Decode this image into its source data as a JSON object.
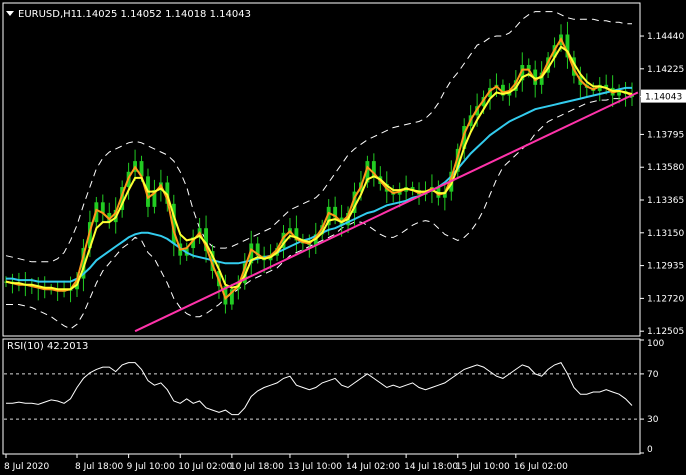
{
  "chart_data": {
    "type": "candlestick",
    "colors": {
      "background": "#000000",
      "frame": "#ffffff",
      "candle": "#22cc22",
      "ma_fast": "#ff9a1a",
      "ma_mid": "#ffff33",
      "ma_slow": "#33ccee",
      "bands": "#ffffff",
      "trendline": "#ff33aa",
      "rsi": "#ffffff",
      "price_tag_bg": "#ffffff",
      "price_tag_text": "#000000"
    },
    "header": {
      "symbol": "EURUSD,H1",
      "ohlc": "1.14025 1.14052 1.14018 1.14043"
    },
    "price_panel": {
      "ylim": [
        1.1248,
        1.1465
      ],
      "y_ticks": [
        "1.14440",
        "1.14225",
        "1.14043",
        "1.13795",
        "1.13580",
        "1.13365",
        "1.13150",
        "1.12935",
        "1.12720",
        "1.12505"
      ],
      "current_price": "1.14043",
      "close": [
        1.1283,
        1.1282,
        1.1281,
        1.1281,
        1.128,
        1.1279,
        1.1278,
        1.1278,
        1.1277,
        1.1277,
        1.1278,
        1.1285,
        1.1305,
        1.1322,
        1.1335,
        1.1328,
        1.1322,
        1.133,
        1.1345,
        1.1355,
        1.1362,
        1.1352,
        1.1332,
        1.1343,
        1.1348,
        1.1334,
        1.1308,
        1.13,
        1.1305,
        1.1312,
        1.1318,
        1.1303,
        1.129,
        1.128,
        1.1268,
        1.1278,
        1.1282,
        1.1295,
        1.1308,
        1.13,
        1.1297,
        1.13,
        1.1305,
        1.1315,
        1.1318,
        1.131,
        1.1308,
        1.1307,
        1.1314,
        1.132,
        1.1332,
        1.1325,
        1.132,
        1.1328,
        1.1342,
        1.1348,
        1.1362,
        1.1352,
        1.1347,
        1.1342,
        1.134,
        1.1342,
        1.1345,
        1.1343,
        1.134,
        1.1342,
        1.1345,
        1.1338,
        1.1342,
        1.1355,
        1.137,
        1.1385,
        1.1392,
        1.1398,
        1.1404,
        1.141,
        1.1412,
        1.1405,
        1.1408,
        1.1415,
        1.1425,
        1.1422,
        1.1412,
        1.142,
        1.143,
        1.1438,
        1.1445,
        1.143,
        1.1418,
        1.1412,
        1.141,
        1.1408,
        1.1412,
        1.141,
        1.1405,
        1.1408,
        1.1406,
        1.1404
      ],
      "ma_fast": [
        1.1283,
        1.1282,
        1.1281,
        1.1281,
        1.128,
        1.1279,
        1.1278,
        1.1278,
        1.1277,
        1.1277,
        1.1278,
        1.1284,
        1.13,
        1.1316,
        1.133,
        1.1328,
        1.1324,
        1.1328,
        1.134,
        1.1351,
        1.1358,
        1.1352,
        1.1338,
        1.1341,
        1.1346,
        1.1337,
        1.1316,
        1.1304,
        1.1305,
        1.131,
        1.1315,
        1.1306,
        1.1294,
        1.1284,
        1.1272,
        1.1276,
        1.128,
        1.1292,
        1.1304,
        1.1301,
        1.1298,
        1.13,
        1.1304,
        1.1312,
        1.1316,
        1.1311,
        1.1309,
        1.1308,
        1.1312,
        1.1318,
        1.1328,
        1.1326,
        1.1322,
        1.1326,
        1.1338,
        1.1345,
        1.1358,
        1.1354,
        1.1349,
        1.1344,
        1.1341,
        1.1342,
        1.1344,
        1.1343,
        1.1341,
        1.1342,
        1.1344,
        1.134,
        1.1341,
        1.1351,
        1.1365,
        1.138,
        1.1389,
        1.1396,
        1.1402,
        1.1408,
        1.1411,
        1.1407,
        1.1408,
        1.1413,
        1.1422,
        1.1422,
        1.1415,
        1.1418,
        1.1427,
        1.1435,
        1.1442,
        1.1433,
        1.1422,
        1.1415,
        1.1411,
        1.1409,
        1.1411,
        1.141,
        1.1407,
        1.1408,
        1.1407,
        1.1405
      ],
      "ma_mid": [
        1.1283,
        1.1282,
        1.1282,
        1.1281,
        1.1281,
        1.128,
        1.1279,
        1.1279,
        1.1278,
        1.1278,
        1.1278,
        1.1281,
        1.1292,
        1.1305,
        1.1318,
        1.1322,
        1.1322,
        1.1325,
        1.1334,
        1.1343,
        1.1351,
        1.1351,
        1.1342,
        1.1342,
        1.1344,
        1.134,
        1.1326,
        1.1314,
        1.131,
        1.1311,
        1.1313,
        1.1308,
        1.13,
        1.1291,
        1.1281,
        1.1279,
        1.128,
        1.1287,
        1.1297,
        1.1299,
        1.1298,
        1.1299,
        1.1302,
        1.1308,
        1.1313,
        1.1312,
        1.131,
        1.1309,
        1.1311,
        1.1315,
        1.1323,
        1.1324,
        1.1322,
        1.1324,
        1.1332,
        1.134,
        1.135,
        1.1352,
        1.135,
        1.1346,
        1.1343,
        1.1343,
        1.1344,
        1.1343,
        1.1342,
        1.1342,
        1.1343,
        1.1341,
        1.1341,
        1.1347,
        1.1358,
        1.1371,
        1.1381,
        1.1389,
        1.1396,
        1.1403,
        1.1407,
        1.1406,
        1.1407,
        1.141,
        1.1417,
        1.1419,
        1.1416,
        1.1417,
        1.1423,
        1.143,
        1.1437,
        1.1434,
        1.1426,
        1.1419,
        1.1414,
        1.1411,
        1.1411,
        1.141,
        1.1408,
        1.1408,
        1.1407,
        1.1406
      ],
      "ma_slow": [
        1.1285,
        1.1285,
        1.1284,
        1.1284,
        1.1284,
        1.1283,
        1.1283,
        1.1283,
        1.1283,
        1.1283,
        1.1283,
        1.1285,
        1.1288,
        1.1292,
        1.1297,
        1.13,
        1.1303,
        1.1306,
        1.1309,
        1.1312,
        1.1314,
        1.1315,
        1.1315,
        1.1314,
        1.1313,
        1.1311,
        1.1308,
        1.1305,
        1.1302,
        1.13,
        1.1299,
        1.1298,
        1.1297,
        1.1296,
        1.1295,
        1.1295,
        1.1295,
        1.1296,
        1.1297,
        1.1298,
        1.1299,
        1.13,
        1.1302,
        1.1304,
        1.1306,
        1.1308,
        1.131,
        1.1311,
        1.1313,
        1.1315,
        1.1317,
        1.1318,
        1.132,
        1.1322,
        1.1324,
        1.1326,
        1.1328,
        1.1329,
        1.1331,
        1.1333,
        1.1334,
        1.1335,
        1.1336,
        1.1338,
        1.1339,
        1.1341,
        1.1343,
        1.1345,
        1.1348,
        1.1352,
        1.1357,
        1.1362,
        1.1367,
        1.1371,
        1.1375,
        1.1379,
        1.1382,
        1.1385,
        1.1388,
        1.139,
        1.1392,
        1.1394,
        1.1396,
        1.1397,
        1.1398,
        1.1399,
        1.14,
        1.1401,
        1.1402,
        1.1403,
        1.1404,
        1.1405,
        1.1406,
        1.1407,
        1.1408,
        1.1409,
        1.141,
        1.141
      ],
      "band_upper": [
        1.13,
        1.1299,
        1.1298,
        1.1297,
        1.1296,
        1.1296,
        1.1296,
        1.1296,
        1.1298,
        1.1302,
        1.131,
        1.132,
        1.1333,
        1.1345,
        1.1357,
        1.1364,
        1.1368,
        1.137,
        1.1372,
        1.1374,
        1.1375,
        1.1374,
        1.1372,
        1.137,
        1.1368,
        1.1366,
        1.1362,
        1.1355,
        1.1345,
        1.133,
        1.1318,
        1.131,
        1.1306,
        1.1305,
        1.1305,
        1.1306,
        1.1308,
        1.131,
        1.1312,
        1.1314,
        1.1316,
        1.1318,
        1.1322,
        1.1326,
        1.133,
        1.1332,
        1.1334,
        1.1336,
        1.1338,
        1.1342,
        1.1348,
        1.1354,
        1.136,
        1.1366,
        1.137,
        1.1373,
        1.1376,
        1.1378,
        1.138,
        1.1382,
        1.1384,
        1.1385,
        1.1386,
        1.1387,
        1.1388,
        1.139,
        1.1394,
        1.14,
        1.1408,
        1.1415,
        1.142,
        1.1426,
        1.1432,
        1.1438,
        1.144,
        1.1443,
        1.1444,
        1.1444,
        1.1446,
        1.145,
        1.1455,
        1.1458,
        1.146,
        1.146,
        1.146,
        1.146,
        1.1458,
        1.1456,
        1.1455,
        1.1455,
        1.1455,
        1.1455,
        1.1454,
        1.1454,
        1.1453,
        1.1453,
        1.1452,
        1.1452
      ],
      "band_lower": [
        1.1268,
        1.1268,
        1.1268,
        1.1267,
        1.1266,
        1.1264,
        1.1262,
        1.126,
        1.1257,
        1.1254,
        1.1252,
        1.1255,
        1.1262,
        1.1272,
        1.1282,
        1.129,
        1.1295,
        1.13,
        1.1305,
        1.1308,
        1.1312,
        1.131,
        1.1302,
        1.1298,
        1.129,
        1.1282,
        1.1272,
        1.1266,
        1.1262,
        1.126,
        1.126,
        1.1262,
        1.1265,
        1.1268,
        1.1272,
        1.1275,
        1.1278,
        1.1281,
        1.1284,
        1.1286,
        1.1288,
        1.129,
        1.1292,
        1.1296,
        1.13,
        1.1302,
        1.1304,
        1.1306,
        1.1308,
        1.131,
        1.1312,
        1.1314,
        1.1318,
        1.132,
        1.1322,
        1.1322,
        1.132,
        1.1317,
        1.1314,
        1.1312,
        1.1312,
        1.1314,
        1.1317,
        1.132,
        1.1322,
        1.1323,
        1.1322,
        1.1318,
        1.1314,
        1.1312,
        1.131,
        1.1312,
        1.1316,
        1.1322,
        1.133,
        1.134,
        1.135,
        1.1358,
        1.1362,
        1.1366,
        1.137,
        1.1374,
        1.138,
        1.1384,
        1.1388,
        1.139,
        1.1392,
        1.1394,
        1.1396,
        1.1398,
        1.14,
        1.1401,
        1.1402,
        1.1402,
        1.1403,
        1.1403,
        1.1404,
        1.1404
      ],
      "trendline": {
        "start": [
          20,
          1.12505
        ],
        "end": [
          97,
          1.14052
        ]
      }
    },
    "rsi_panel": {
      "label": "RSI(10) 42.2013",
      "ylim": [
        0,
        100
      ],
      "y_ticks": [
        "100",
        "70",
        "30",
        "0"
      ],
      "levels": [
        70,
        30
      ],
      "values": [
        44,
        44,
        45,
        44,
        44,
        43,
        45,
        47,
        46,
        44,
        48,
        58,
        66,
        71,
        74,
        76,
        76,
        72,
        78,
        80,
        80,
        74,
        64,
        60,
        62,
        56,
        46,
        44,
        48,
        44,
        46,
        40,
        38,
        36,
        38,
        34,
        34,
        40,
        50,
        55,
        58,
        60,
        62,
        66,
        68,
        60,
        58,
        56,
        58,
        62,
        64,
        66,
        60,
        58,
        62,
        66,
        70,
        66,
        62,
        58,
        60,
        58,
        60,
        62,
        58,
        56,
        58,
        60,
        62,
        66,
        70,
        74,
        76,
        78,
        76,
        72,
        68,
        66,
        70,
        74,
        78,
        76,
        70,
        68,
        74,
        78,
        80,
        70,
        58,
        52,
        52,
        54,
        54,
        56,
        54,
        52,
        48,
        42
      ]
    },
    "x_axis": {
      "ticks": [
        {
          "i": 0,
          "label": "8 Jul 2020"
        },
        {
          "i": 11,
          "label": "8 Jul 18:00"
        },
        {
          "i": 19,
          "label": "9 Jul 10:00"
        },
        {
          "i": 27,
          "label": "10 Jul 02:00"
        },
        {
          "i": 35,
          "label": "10 Jul 18:00"
        },
        {
          "i": 44,
          "label": "13 Jul 10:00"
        },
        {
          "i": 53,
          "label": "14 Jul 02:00"
        },
        {
          "i": 62,
          "label": "14 Jul 18:00"
        },
        {
          "i": 70,
          "label": "15 Jul 10:00"
        },
        {
          "i": 79,
          "label": "16 Jul 02:00"
        }
      ]
    }
  }
}
